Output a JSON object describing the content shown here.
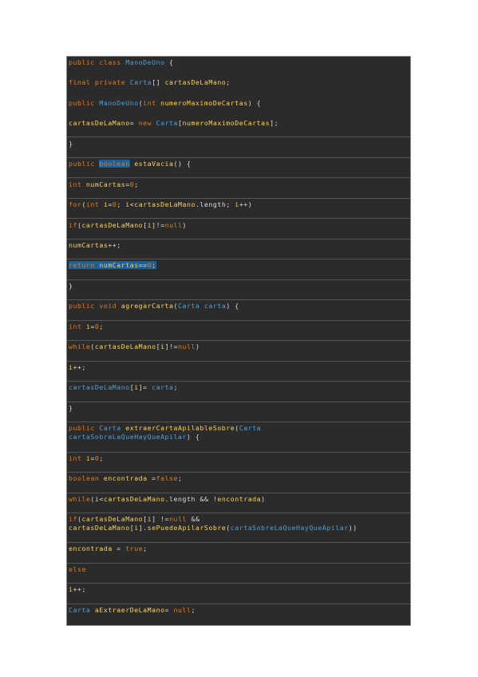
{
  "document": {
    "code_lines": [
      {
        "tokens": [
          {
            "text": "public class ",
            "c": "#e07b20"
          },
          {
            "text": "ManoDeUno",
            "c": "#4aa0d8"
          },
          {
            "text": " {",
            "c": "#dcdcdc"
          }
        ]
      },
      {
        "tokens": [
          {
            "text": "final private ",
            "c": "#e07b20"
          },
          {
            "text": "Carta",
            "c": "#4aa0d8"
          },
          {
            "text": "[] ",
            "c": "#dcdcdc"
          },
          {
            "text": "cartasDeLaMano",
            "c": "#ffd24d"
          },
          {
            "text": ";",
            "c": "#dcdcdc"
          }
        ]
      },
      {
        "tokens": [
          {
            "text": "public ",
            "c": "#e07b20"
          },
          {
            "text": "ManoDeUno",
            "c": "#4aa0d8"
          },
          {
            "text": "(",
            "c": "#dcdcdc"
          },
          {
            "text": "int ",
            "c": "#e07b20"
          },
          {
            "text": "numeroMaximoDeCartas",
            "c": "#ffd24d"
          },
          {
            "text": ") {",
            "c": "#dcdcdc"
          }
        ]
      },
      {
        "tokens": [
          {
            "text": "cartasDeLaMano",
            "c": "#ffd24d"
          },
          {
            "text": "= ",
            "c": "#dcdcdc"
          },
          {
            "text": "new ",
            "c": "#e07b20"
          },
          {
            "text": "Carta",
            "c": "#4aa0d8"
          },
          {
            "text": "[",
            "c": "#dcdcdc"
          },
          {
            "text": "numeroMaximoDeCartas",
            "c": "#ffd24d"
          },
          {
            "text": "];",
            "c": "#dcdcdc"
          }
        ]
      },
      {
        "tokens": [
          {
            "text": "}",
            "c": "#dcdcdc"
          }
        ]
      },
      {
        "tokens": [
          {
            "text": "public ",
            "c": "#e07b20"
          },
          {
            "text": "boolean",
            "c": "#e07b20",
            "hl": true
          },
          {
            "text": " ",
            "c": "#dcdcdc"
          },
          {
            "text": "estaVacia",
            "c": "#ffd24d"
          },
          {
            "text": "() {",
            "c": "#dcdcdc"
          }
        ]
      },
      {
        "tokens": [
          {
            "text": "int ",
            "c": "#e07b20"
          },
          {
            "text": "numCartas",
            "c": "#ffd24d"
          },
          {
            "text": "=",
            "c": "#dcdcdc"
          },
          {
            "text": "0",
            "c": "#e07b20"
          },
          {
            "text": ";",
            "c": "#dcdcdc"
          }
        ]
      },
      {
        "tokens": [
          {
            "text": "for",
            "c": "#e07b20"
          },
          {
            "text": "(",
            "c": "#dcdcdc"
          },
          {
            "text": "int ",
            "c": "#e07b20"
          },
          {
            "text": "i",
            "c": "#ffd24d"
          },
          {
            "text": "=",
            "c": "#dcdcdc"
          },
          {
            "text": "0",
            "c": "#e07b20"
          },
          {
            "text": "; ",
            "c": "#dcdcdc"
          },
          {
            "text": "i",
            "c": "#ffd24d"
          },
          {
            "text": "<",
            "c": "#dcdcdc"
          },
          {
            "text": "cartasDeLaMano",
            "c": "#ffd24d"
          },
          {
            "text": ".length; ",
            "c": "#dcdcdc"
          },
          {
            "text": "i",
            "c": "#ffd24d"
          },
          {
            "text": "++)",
            "c": "#dcdcdc"
          }
        ]
      },
      {
        "tokens": [
          {
            "text": "if",
            "c": "#e07b20"
          },
          {
            "text": "(",
            "c": "#dcdcdc"
          },
          {
            "text": "cartasDeLaMano",
            "c": "#ffd24d"
          },
          {
            "text": "[",
            "c": "#dcdcdc"
          },
          {
            "text": "i",
            "c": "#ffd24d"
          },
          {
            "text": "]!=",
            "c": "#dcdcdc"
          },
          {
            "text": "null",
            "c": "#e07b20"
          },
          {
            "text": ")",
            "c": "#dcdcdc"
          }
        ]
      },
      {
        "tokens": [
          {
            "text": "numCartas",
            "c": "#ffd24d"
          },
          {
            "text": "++;",
            "c": "#dcdcdc"
          }
        ]
      },
      {
        "tokens": [
          {
            "text": "return ",
            "c": "#e07b20"
          },
          {
            "text": "numCartas",
            "c": "#ffd24d"
          },
          {
            "text": "==",
            "c": "#dcdcdc"
          },
          {
            "text": "0",
            "c": "#e07b20"
          },
          {
            "text": ";",
            "c": "#dcdcdc"
          }
        ],
        "hl": true
      },
      {
        "tokens": [
          {
            "text": "}",
            "c": "#dcdcdc"
          }
        ]
      },
      {
        "tokens": [
          {
            "text": "public void ",
            "c": "#e07b20"
          },
          {
            "text": "agregarCarta",
            "c": "#ffd24d"
          },
          {
            "text": "(",
            "c": "#dcdcdc"
          },
          {
            "text": "Carta ",
            "c": "#4aa0d8"
          },
          {
            "text": "carta",
            "c": "#4aa0d8"
          },
          {
            "text": ") {",
            "c": "#dcdcdc"
          }
        ]
      },
      {
        "tokens": [
          {
            "text": "int ",
            "c": "#e07b20"
          },
          {
            "text": "i",
            "c": "#ffd24d"
          },
          {
            "text": "=",
            "c": "#dcdcdc"
          },
          {
            "text": "0",
            "c": "#e07b20"
          },
          {
            "text": ";",
            "c": "#dcdcdc"
          }
        ]
      },
      {
        "tokens": [
          {
            "text": "while",
            "c": "#e07b20"
          },
          {
            "text": "(",
            "c": "#dcdcdc"
          },
          {
            "text": "cartasDeLaMano",
            "c": "#ffd24d"
          },
          {
            "text": "[",
            "c": "#dcdcdc"
          },
          {
            "text": "i",
            "c": "#ffd24d"
          },
          {
            "text": "]!=",
            "c": "#dcdcdc"
          },
          {
            "text": "null",
            "c": "#e07b20"
          },
          {
            "text": ")",
            "c": "#dcdcdc"
          }
        ]
      },
      {
        "tokens": [
          {
            "text": "i",
            "c": "#ffd24d"
          },
          {
            "text": "++;",
            "c": "#dcdcdc"
          }
        ]
      },
      {
        "tokens": [
          {
            "text": "cartasDeLaMano",
            "c": "#4aa0d8"
          },
          {
            "text": "[",
            "c": "#dcdcdc"
          },
          {
            "text": "i",
            "c": "#ffd24d"
          },
          {
            "text": "]= ",
            "c": "#dcdcdc"
          },
          {
            "text": "carta",
            "c": "#4aa0d8"
          },
          {
            "text": ";",
            "c": "#dcdcdc"
          }
        ]
      },
      {
        "tokens": [
          {
            "text": "}",
            "c": "#dcdcdc"
          }
        ]
      },
      {
        "tokens": [
          {
            "text": "public ",
            "c": "#e07b20"
          },
          {
            "text": "Carta ",
            "c": "#4aa0d8"
          },
          {
            "text": "extraerCartaApilableSobre",
            "c": "#ffd24d"
          },
          {
            "text": "(",
            "c": "#dcdcdc"
          },
          {
            "text": "Carta",
            "c": "#4aa0d8"
          }
        ],
        "line2": [
          {
            "text": "cartaSobreLaQueHayQueApilar",
            "c": "#4aa0d8"
          },
          {
            "text": ") {",
            "c": "#dcdcdc"
          }
        ]
      },
      {
        "tokens": [
          {
            "text": "int ",
            "c": "#e07b20"
          },
          {
            "text": "i",
            "c": "#ffd24d"
          },
          {
            "text": "=",
            "c": "#dcdcdc"
          },
          {
            "text": "0",
            "c": "#e07b20"
          },
          {
            "text": ";",
            "c": "#dcdcdc"
          }
        ]
      },
      {
        "tokens": [
          {
            "text": "boolean ",
            "c": "#e07b20"
          },
          {
            "text": "encontrada",
            "c": "#ffd24d"
          },
          {
            "text": " =",
            "c": "#dcdcdc"
          },
          {
            "text": "false",
            "c": "#e07b20"
          },
          {
            "text": ";",
            "c": "#dcdcdc"
          }
        ]
      },
      {
        "tokens": [
          {
            "text": "while",
            "c": "#e07b20"
          },
          {
            "text": "(",
            "c": "#dcdcdc"
          },
          {
            "text": "i",
            "c": "#ffd24d"
          },
          {
            "text": "<",
            "c": "#dcdcdc"
          },
          {
            "text": "cartasDeLaMano",
            "c": "#ffd24d"
          },
          {
            "text": ".length && !",
            "c": "#dcdcdc"
          },
          {
            "text": "encontrada",
            "c": "#ffd24d"
          },
          {
            "text": ")",
            "c": "#dcdcdc"
          }
        ]
      },
      {
        "tokens": [
          {
            "text": "if",
            "c": "#e07b20"
          },
          {
            "text": "(",
            "c": "#dcdcdc"
          },
          {
            "text": "cartasDeLaMano",
            "c": "#ffd24d"
          },
          {
            "text": "[",
            "c": "#dcdcdc"
          },
          {
            "text": "i",
            "c": "#ffd24d"
          },
          {
            "text": "] !=",
            "c": "#dcdcdc"
          },
          {
            "text": "null",
            "c": "#e07b20"
          },
          {
            "text": " &&",
            "c": "#dcdcdc"
          }
        ],
        "line2": [
          {
            "text": "cartasDeLaMano",
            "c": "#ffd24d"
          },
          {
            "text": "[",
            "c": "#dcdcdc"
          },
          {
            "text": "i",
            "c": "#ffd24d"
          },
          {
            "text": "].",
            "c": "#dcdcdc"
          },
          {
            "text": "sePuedeApilarSobre",
            "c": "#ffd24d"
          },
          {
            "text": "(",
            "c": "#dcdcdc"
          },
          {
            "text": "cartaSobreLaQueHayQueApilar",
            "c": "#4aa0d8"
          },
          {
            "text": "))",
            "c": "#dcdcdc"
          }
        ]
      },
      {
        "tokens": [
          {
            "text": "encontrada",
            "c": "#ffd24d"
          },
          {
            "text": " = ",
            "c": "#dcdcdc"
          },
          {
            "text": "true",
            "c": "#e07b20"
          },
          {
            "text": ";",
            "c": "#dcdcdc"
          }
        ]
      },
      {
        "tokens": [
          {
            "text": "else",
            "c": "#e07b20"
          }
        ]
      },
      {
        "tokens": [
          {
            "text": "i",
            "c": "#ffd24d"
          },
          {
            "text": "++;",
            "c": "#dcdcdc"
          }
        ]
      },
      {
        "tokens": [
          {
            "text": "Carta ",
            "c": "#4aa0d8"
          },
          {
            "text": "aExtraerDeLaMano",
            "c": "#ffd24d"
          },
          {
            "text": "= ",
            "c": "#dcdcdc"
          },
          {
            "text": "null",
            "c": "#e07b20"
          },
          {
            "text": ";",
            "c": "#dcdcdc"
          }
        ]
      }
    ],
    "colors": {
      "background": "#2b2b2b",
      "keyword": "#e07b20",
      "type": "#4aa0d8",
      "identifier": "#ffd24d",
      "punctuation": "#dcdcdc",
      "highlight": "#1f5f93"
    }
  }
}
